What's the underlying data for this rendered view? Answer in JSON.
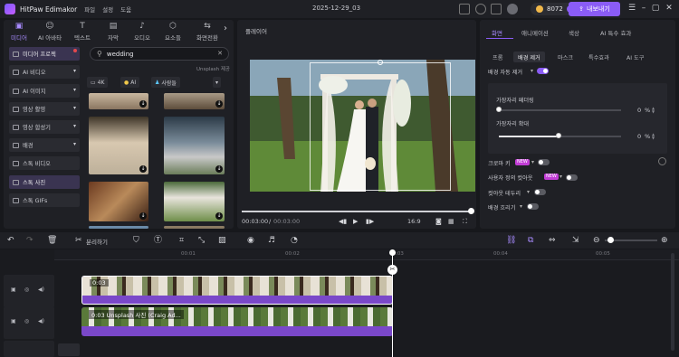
{
  "app": {
    "name": "HitPaw Edimakor",
    "document": "2025-12-29_03"
  },
  "menu": [
    "파일",
    "설정",
    "도움"
  ],
  "account": {
    "coins": "8072",
    "export_label": "내보내기"
  },
  "left_tabs": [
    {
      "label": "미디어",
      "icon": "media-icon"
    },
    {
      "label": "AI 아바타",
      "icon": "ai-avatar-icon"
    },
    {
      "label": "텍스트",
      "icon": "text-icon"
    },
    {
      "label": "자막",
      "icon": "subtitle-icon"
    },
    {
      "label": "오디오",
      "icon": "audio-icon"
    },
    {
      "label": "요소들",
      "icon": "elements-icon"
    },
    {
      "label": "화면전환",
      "icon": "transition-icon"
    }
  ],
  "sidebar": [
    {
      "label": "미디어 프로젝"
    },
    {
      "label": "AI 비디오"
    },
    {
      "label": "AI 이미지"
    },
    {
      "label": "영상 활영"
    },
    {
      "label": "영상 합성기"
    },
    {
      "label": "배경"
    },
    {
      "label": "스톡 비디오"
    },
    {
      "label": "스톡 사진"
    },
    {
      "label": "스톡 GIFs"
    }
  ],
  "search": {
    "value": "wedding",
    "provider": "Unsplash 제공"
  },
  "filters": [
    "4K",
    "AI",
    "사람들"
  ],
  "player": {
    "title": "플레이어",
    "current_time": "00:03:00",
    "total_time": "00:03:00",
    "aspect": "16:9"
  },
  "right_tabs": [
    "화면",
    "애니메이션",
    "색상",
    "AI 특수 효과"
  ],
  "right_subtabs": [
    "프롬",
    "배경 제거",
    "마스크",
    "특수효과",
    "AI 도구"
  ],
  "bg_removal": {
    "auto_label": "배경 자동 제거",
    "edge_label": "가장자리 페더링",
    "edge_value": "0",
    "expand_label": "가장자리 확대",
    "expand_value": "0",
    "unit": "%"
  },
  "options": [
    {
      "label": "크로마 키",
      "new": true
    },
    {
      "label": "사용자 정의 컷아웃",
      "new": true
    },
    {
      "label": "컷아웃 테두리",
      "new": false
    },
    {
      "label": "배경 흐리기",
      "new": false
    }
  ],
  "new_badge": "NEW",
  "toolbar": {
    "split_label": "분리하기"
  },
  "ruler": [
    "00:01",
    "00:02",
    "00:03",
    "00:04",
    "00:05"
  ],
  "tracks": [
    {
      "label": "0:03",
      "color": "#7a48c9"
    },
    {
      "label": "0:03 Unsplash 사진 (Craig Ad...",
      "color": "#7a48c9"
    }
  ],
  "colors": {
    "accent": "#8a5cf6",
    "badge": "#c23dd6",
    "bg": "#17181c"
  }
}
